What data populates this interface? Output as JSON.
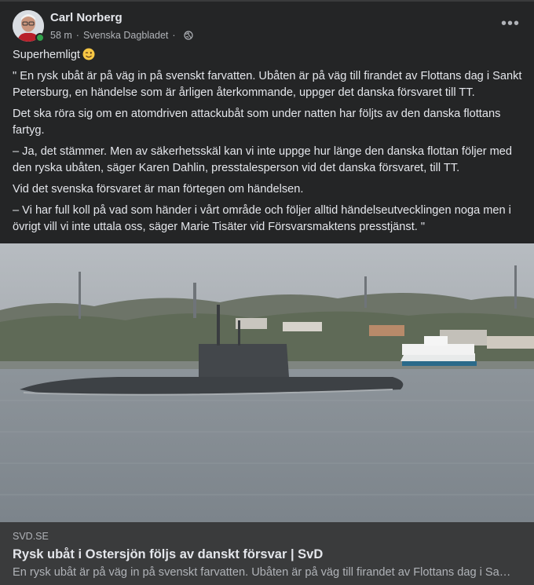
{
  "post": {
    "author": "Carl Norberg",
    "time": "58 m",
    "separator": "·",
    "source": "Svenska Dagbladet",
    "audience_icon": "globe-icon",
    "more_icon": "more-options-icon",
    "more_label": "•••"
  },
  "content": {
    "lead": "Superhemligt",
    "emoji": "winking-face-emoji",
    "paragraphs": [
      "\" En rysk ubåt är på väg in på svenskt farvatten. Ubåten är på väg till firandet av Flottans dag i Sankt Petersburg, en händelse som är årligen återkommande, uppger det danska försvaret till TT.",
      "Det ska röra sig om en atomdriven attackubåt som under natten har följts av den danska flottans fartyg.",
      "– Ja, det stämmer. Men av säkerhetsskäl kan vi inte uppge hur länge den danska flottan följer med den ryska ubåten, säger Karen Dahlin, presstalesperson vid det danska försvaret, till TT.",
      "Vid det svenska försvaret är man förtegen om händelsen.",
      "– Vi har full koll på vad som händer i vårt område och följer alltid händelseutvecklingen noga men i övrigt vill vi inte uttala oss, säger Marie Tisäter vid Försvarsmaktens presstjänst. \""
    ]
  },
  "link_preview": {
    "domain": "SVD.SE",
    "title": "Rysk ubåt i Ostersjön följs av danskt försvar | SvD",
    "description": "En rysk ubåt är på väg in på svenskt farvatten. Ubåten är på väg till firandet av Flottans dag i Sankt Petersburg, en händelse som är årligen återkommande."
  },
  "colors": {
    "card_bg": "#242526",
    "link_bg": "#3a3b3c",
    "text_primary": "#e4e6eb",
    "text_secondary": "#b0b3b8",
    "online": "#31a24c"
  }
}
